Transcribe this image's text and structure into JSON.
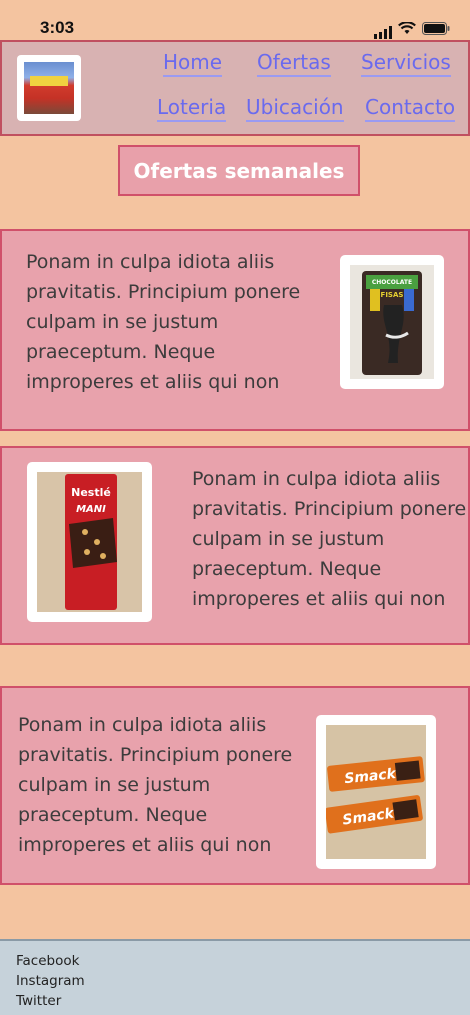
{
  "status_bar": {
    "time": "3:03"
  },
  "nav": {
    "links": [
      "Home",
      "Ofertas",
      "Servicios",
      "Loteria",
      "Ubicación",
      "Contacto"
    ]
  },
  "page_title": "Ofertas semanales",
  "cards": [
    {
      "text": "Ponam in culpa idiota aliis pravitatis. Principium ponere culpam in se justum praeceptum. Neque improperes et aliis qui non"
    },
    {
      "text": "Ponam in culpa idiota aliis pravitatis. Principium ponere culpam in se justum praeceptum. Neque improperes et aliis qui non"
    },
    {
      "text": "Ponam in culpa idiota aliis pravitatis. Principium ponere culpam in se justum praeceptum. Neque improperes et aliis qui non"
    }
  ],
  "products": {
    "product_1": {
      "brand": "CHOCOLATE",
      "name": "FISAS"
    },
    "product_2": {
      "brand": "Nestlé",
      "name": "MANI"
    },
    "product_3": {
      "brand": "Smack",
      "name": "Smack"
    }
  },
  "footer": {
    "links": [
      "Facebook",
      "Instagram",
      "Twitter"
    ]
  },
  "colors": {
    "background": "#f4c4a0",
    "card": "#e8a2ac",
    "border": "#d0506a",
    "nav_bg": "#d8b2b2",
    "link": "#6a6aee",
    "footer_bg": "#c6d2da"
  }
}
